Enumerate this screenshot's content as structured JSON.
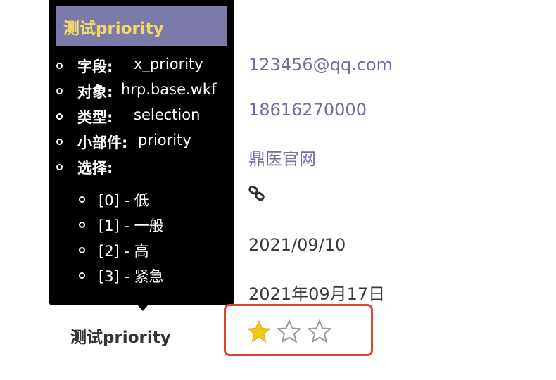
{
  "tooltip": {
    "title": "测试priority",
    "rows": [
      {
        "label": "字段:",
        "value": "x_priority"
      },
      {
        "label": "对象:",
        "value": "hrp.base.wkf"
      },
      {
        "label": "类型:",
        "value": "selection"
      },
      {
        "label": "小部件:",
        "value": "priority"
      },
      {
        "label": "选择:",
        "value": ""
      }
    ],
    "options": [
      "[0] - 低",
      "[1] - 一般",
      "[2] - 高",
      "[3] - 紧急"
    ]
  },
  "record": {
    "email": "123456@qq.com",
    "phone": "18616270000",
    "website": "鼎医官网",
    "link_icon": "chain-link-icon",
    "date": "2021/09/10",
    "date_cn": "2021年09月17日",
    "priority_label": "测试priority"
  },
  "priority_stars": {
    "total": 3,
    "filled": 1,
    "filled_color": "#f5c518",
    "empty_color": "#9a9a9a"
  },
  "colors": {
    "tooltip_header": "#7c7aa8",
    "tooltip_title": "#f2d86a",
    "link": "#6f6fa6",
    "highlight_border": "#e0432f"
  }
}
